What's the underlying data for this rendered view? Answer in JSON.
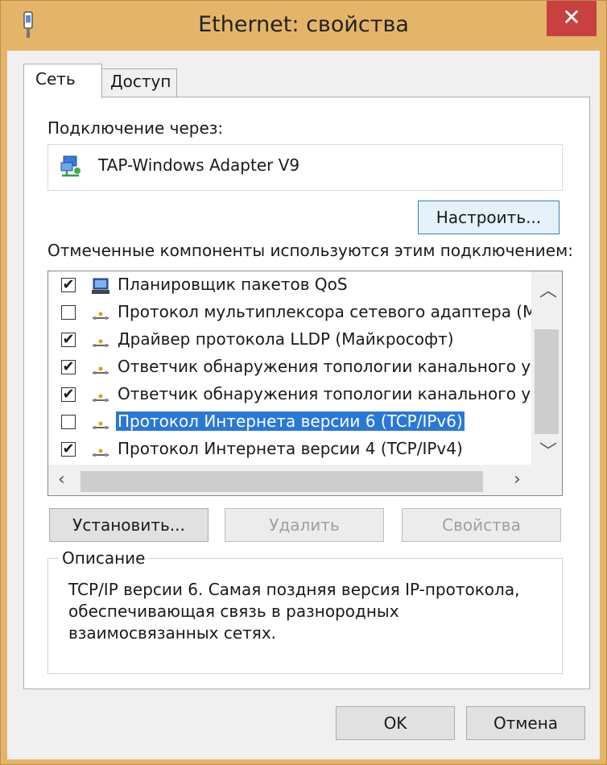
{
  "window": {
    "title": "Ethernet: свойства",
    "close_glyph": "✕",
    "icon": "network-plug-icon"
  },
  "tabs": [
    {
      "label": "Сеть",
      "active": true
    },
    {
      "label": "Доступ",
      "active": false
    }
  ],
  "connect_via": {
    "label": "Подключение через:",
    "adapter_name": "TAP-Windows Adapter V9",
    "adapter_icon": "network-adapter-icon",
    "configure_button": "Настроить..."
  },
  "components": {
    "label": "Отмеченные компоненты используются этим подключением:",
    "items": [
      {
        "label": "Планировщик пакетов QoS",
        "checked": true,
        "icon": "qos-scheduler-icon",
        "selected": false
      },
      {
        "label": "Протокол мультиплексора сетевого адаптера (Ма",
        "checked": false,
        "icon": "protocol-icon",
        "selected": false
      },
      {
        "label": "Драйвер протокола LLDP (Майкрософт)",
        "checked": true,
        "icon": "protocol-icon",
        "selected": false
      },
      {
        "label": "Ответчик обнаружения топологии канального уров",
        "checked": true,
        "icon": "protocol-icon",
        "selected": false
      },
      {
        "label": "Ответчик обнаружения топологии канального уров",
        "checked": true,
        "icon": "protocol-icon",
        "selected": false
      },
      {
        "label": "Протокол Интернета версии 6 (TCP/IPv6)",
        "checked": false,
        "icon": "protocol-icon",
        "selected": true
      },
      {
        "label": "Протокол Интернета версии 4 (TCP/IPv4)",
        "checked": true,
        "icon": "protocol-icon",
        "selected": false
      }
    ],
    "check_glyph": "✔"
  },
  "actions": {
    "install": "Установить...",
    "remove": "Удалить",
    "properties": "Свойства"
  },
  "description": {
    "legend": "Описание",
    "text": "TCP/IP версии 6. Самая поздняя версия IP-протокола, обеспечивающая связь в разнородных взаимосвязанных сетях."
  },
  "footer": {
    "ok": "OK",
    "cancel": "Отмена"
  },
  "colors": {
    "title_bar": "#e4b569",
    "selection": "#2a78d6",
    "close": "#c84040"
  }
}
